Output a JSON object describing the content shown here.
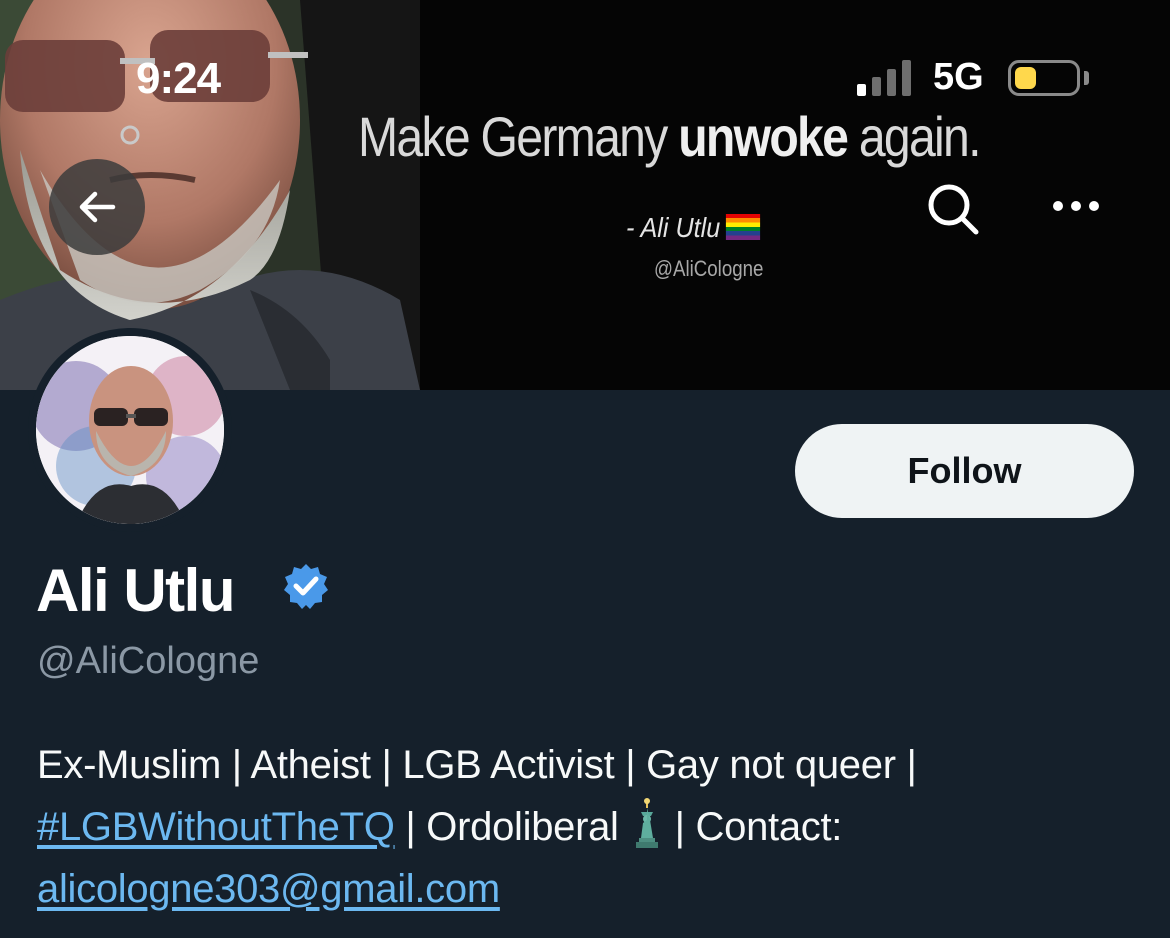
{
  "status_bar": {
    "time": "9:24",
    "network": "5G",
    "signal_bars_active": 1,
    "signal_bars_total": 4,
    "battery_level": 0.35,
    "battery_color": "#ffd84c"
  },
  "banner": {
    "quote_prefix": "Make Germany ",
    "quote_bold": "unwoke",
    "quote_suffix": " again.",
    "attribution": "- Ali Utlu",
    "banner_handle": "@AliCologne"
  },
  "nav": {
    "back_icon": "arrow-left-icon",
    "search_icon": "search-icon",
    "more_icon": "more-horizontal-icon"
  },
  "profile": {
    "display_name": "Ali Utlu",
    "verified": true,
    "verified_color": "#4a99e9",
    "handle": "@AliCologne",
    "follow_label": "Follow",
    "bio": {
      "line1": "Ex-Muslim | Atheist | LGB Activist | Gay not queer |",
      "hashtag": "#LGBWithoutTheTQ",
      "after_hashtag": " | Ordoliberal",
      "emoji_icon": "statue-of-liberty-icon",
      "contact": "| Contact:",
      "email": "alicologne303@gmail.com"
    }
  },
  "colors": {
    "background": "#15202b",
    "link": "#6cb8f0",
    "secondary_text": "#8b98a5",
    "follow_button_bg": "#eff3f4"
  }
}
